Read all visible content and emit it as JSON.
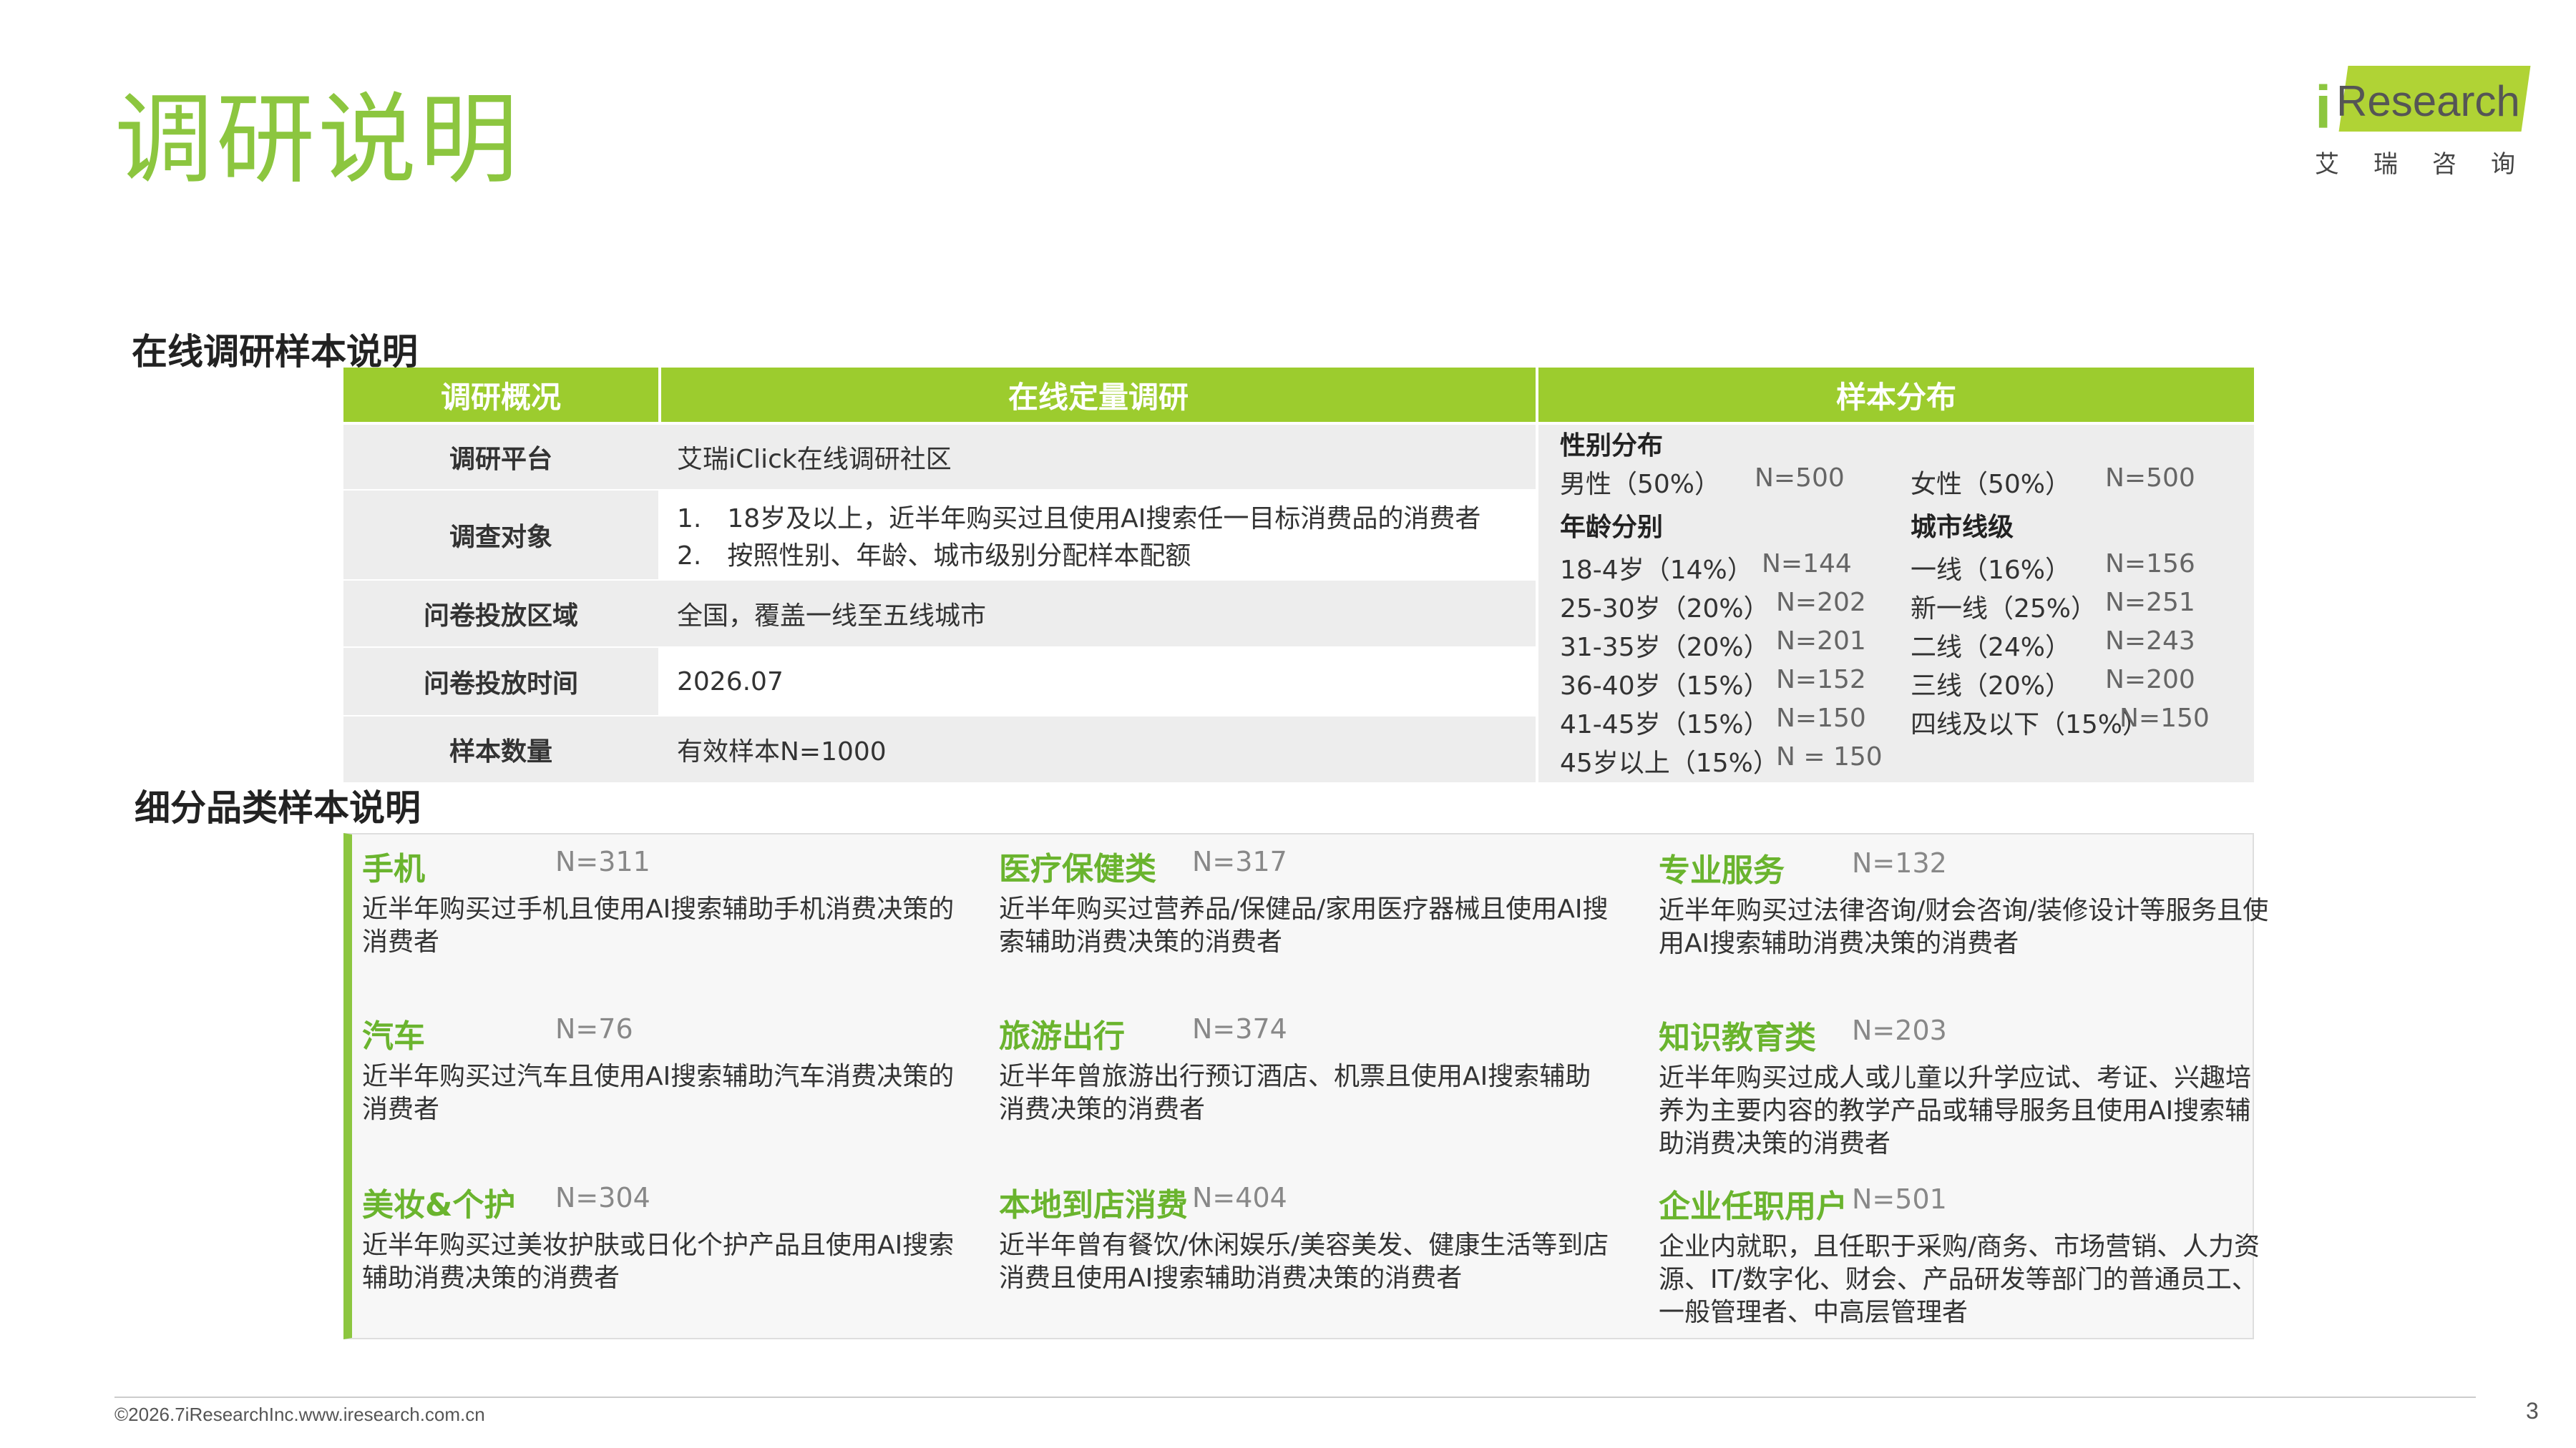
{
  "page": {
    "title": "调研说明",
    "logo": {
      "i": "i",
      "brand": "Research",
      "sub": "艾瑞咨询"
    },
    "footer": "©2026.7iResearchInc.www.iresearch.com.cn",
    "page_number": "3"
  },
  "colors": {
    "accent": "#8cc63f",
    "header": "#9ccc2e",
    "category": "#6ab42e"
  },
  "online": {
    "section_title": "在线调研样本说明",
    "headers": [
      "调研概况",
      "在线定量调研",
      "样本分布"
    ],
    "rows": [
      {
        "label": "调研平台",
        "values": [
          "艾瑞iClick在线调研社区"
        ]
      },
      {
        "label": "调查对象",
        "values": [
          "1.　18岁及以上，近半年购买过且使用AI搜索任一目标消费品的消费者",
          "2.　按照性别、年龄、城市级别分配样本配额"
        ]
      },
      {
        "label": "问卷投放区域",
        "values": [
          "全国，覆盖一线至五线城市"
        ]
      },
      {
        "label": "问卷投放时间",
        "values": [
          "2026.07"
        ]
      },
      {
        "label": "样本数量",
        "values": [
          "有效样本N=1000"
        ]
      }
    ],
    "distribution": {
      "gender": {
        "title": "性别分布",
        "items": [
          {
            "label": "男性（50%）",
            "n": "N=500"
          },
          {
            "label": "女性（50%）",
            "n": "N=500"
          }
        ]
      },
      "age": {
        "title": "年龄分别",
        "items": [
          {
            "label": "18-4岁（14%）",
            "n": "N=144"
          },
          {
            "label": "25-30岁（20%）",
            "n": "N=202"
          },
          {
            "label": "31-35岁（20%）",
            "n": "N=201"
          },
          {
            "label": "36-40岁（15%）",
            "n": "N=152"
          },
          {
            "label": "41-45岁（15%）",
            "n": "N=150"
          },
          {
            "label": "45岁以上（15%）",
            "n": "N = 150"
          }
        ]
      },
      "city": {
        "title": "城市线级",
        "items": [
          {
            "label": "一线（16%）",
            "n": "N=156"
          },
          {
            "label": "新一线（25%）",
            "n": "N=251"
          },
          {
            "label": "二线（24%）",
            "n": "N=243"
          },
          {
            "label": "三线（20%）",
            "n": "N=200"
          },
          {
            "label": "四线及以下（15%）",
            "n": "N=150"
          }
        ]
      }
    }
  },
  "categories": {
    "section_title": "细分品类样本说明",
    "items": [
      {
        "name": "手机",
        "count": "N=311",
        "desc": "近半年购买过手机且使用AI搜索辅助手机消费决策的消费者"
      },
      {
        "name": "医疗保健类",
        "count": "N=317",
        "desc": "近半年购买过营养品/保健品/家用医疗器械且使用AI搜索辅助消费决策的消费者"
      },
      {
        "name": "专业服务",
        "count": "N=132",
        "desc": "近半年购买过法律咨询/财会咨询/装修设计等服务且使用AI搜索辅助消费决策的消费者"
      },
      {
        "name": "汽车",
        "count": "N=76",
        "desc": "近半年购买过汽车且使用AI搜索辅助汽车消费决策的消费者"
      },
      {
        "name": "旅游出行",
        "count": "N=374",
        "desc": "近半年曾旅游出行预订酒店、机票且使用AI搜索辅助消费决策的消费者"
      },
      {
        "name": "知识教育类",
        "count": "N=203",
        "desc": "近半年购买过成人或儿童以升学应试、考证、兴趣培养为主要内容的教学产品或辅导服务且使用AI搜索辅助消费决策的消费者"
      },
      {
        "name": "美妆&个护",
        "count": "N=304",
        "desc": "近半年购买过美妆护肤或日化个护产品且使用AI搜索辅助消费决策的消费者"
      },
      {
        "name": "本地到店消费",
        "count": "N=404",
        "desc": "近半年曾有餐饮/休闲娱乐/美容美发、健康生活等到店消费且使用AI搜索辅助消费决策的消费者"
      },
      {
        "name": "企业任职用户",
        "count": "N=501",
        "desc": "企业内就职，且任职于采购/商务、市场营销、人力资源、IT/数字化、财会、产品研发等部门的普通员工、一般管理者、中高层管理者"
      }
    ]
  }
}
